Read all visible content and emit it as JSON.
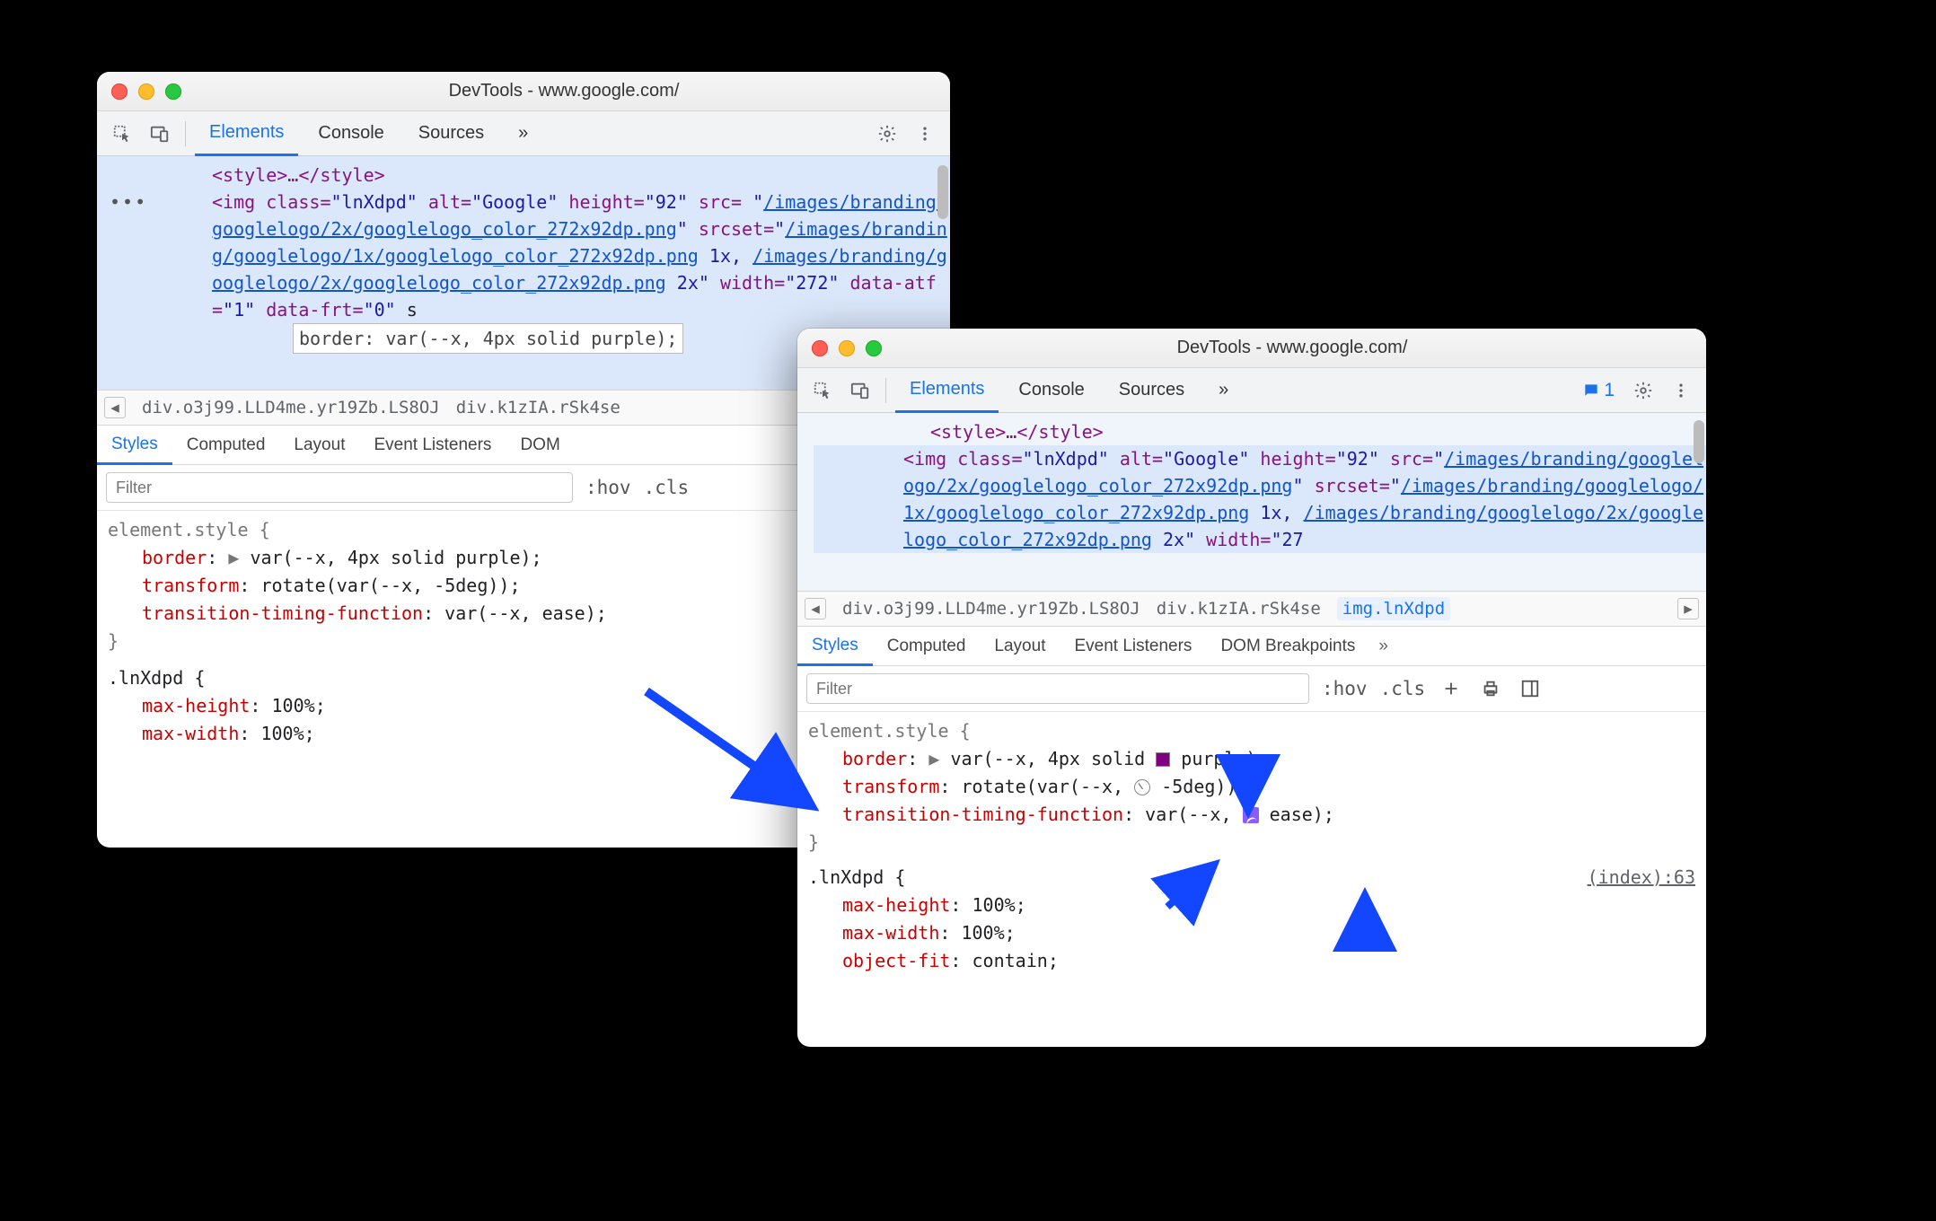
{
  "title": "DevTools - www.google.com/",
  "toolbar": {
    "tabs": [
      "Elements",
      "Console",
      "Sources"
    ],
    "more_glyph": "»",
    "msg_count": "1"
  },
  "dom": {
    "style_close": "<style>…</style>",
    "img_open1": "<img",
    "attr_class_n": "class",
    "attr_class_v": "\"lnXdpd\"",
    "attr_alt_n": "alt",
    "attr_alt_v": "\"Google\"",
    "attr_height_n": "height",
    "attr_height_v": "\"92\"",
    "attr_src_n": "src",
    "src_link": "/images/branding/googlelogo/2x/googlelogo_color_272x92dp.png",
    "attr_srcset_n": "srcset",
    "srcset_link1": "/images/branding/googlelogo/1x/googlelogo_color_272x92dp.png",
    "srcset_1x": " 1x, ",
    "srcset_link2": "/images/branding/googlelogo/2x/googlelogo_color_272x92dp.png",
    "srcset_2x_left": " 2x\"",
    "attr_width_n": "width",
    "attr_width_v": "\"272\"",
    "attr_dataatf_n": "data-atf",
    "attr_dataatf_v": "\"1\"",
    "attr_datafrt_n": "data-frt",
    "attr_datafrt_v": "\"0\"",
    "trailing_s": " s",
    "inline_border": "border: var(--x, 4px solid purple);",
    "width_v2": "\"27"
  },
  "crumbs": {
    "c1": "div.o3j99.LLD4me.yr19Zb.LS8OJ",
    "c2": "div.k1zIA.rSk4se",
    "c3": "img.lnXdpd"
  },
  "subtabs": [
    "Styles",
    "Computed",
    "Layout",
    "Event Listeners",
    "DOM Breakpoints"
  ],
  "subtabs_short": "DOM ",
  "filter": {
    "placeholder": "Filter",
    "hov": ":hov",
    "cls": ".cls"
  },
  "rules": {
    "element_style": "element.style {",
    "border_prop": "border",
    "border_pre": ": ",
    "var_open": "var",
    "paren_open": "(",
    "dashx": "--x",
    "comma": ", ",
    "fourpx_solid": "4px solid ",
    "purple": "purple",
    "close_paren_semi": ");",
    "transform_prop": "transform",
    "rotate": "rotate",
    "neg5": "-5deg",
    "double_close": "));",
    "ttf_prop": "transition-timing-function",
    "ease": "ease",
    "close_brace": "}",
    "lnxdpd_sel": ".lnXdpd {",
    "maxh": "max-height",
    "hundred": "100%",
    "semi": ";",
    "maxw": "max-width",
    "objfit": "object-fit",
    "contain": "contain",
    "index_source": "(index):63",
    "triangle": "▶"
  }
}
